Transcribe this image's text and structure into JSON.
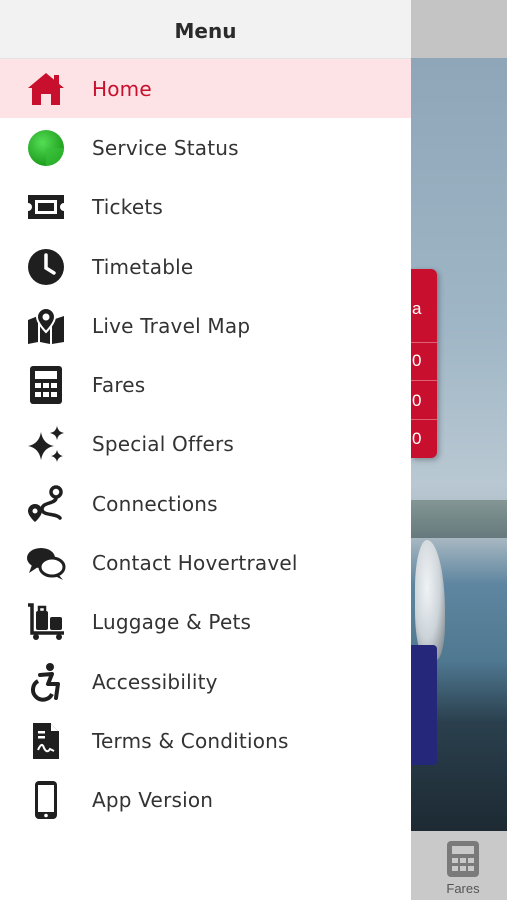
{
  "drawer": {
    "title": "Menu",
    "items": [
      {
        "label": "Home",
        "icon": "home-icon",
        "active": true
      },
      {
        "label": "Service Status",
        "icon": "status-indicator-icon",
        "active": false
      },
      {
        "label": "Tickets",
        "icon": "ticket-icon",
        "active": false
      },
      {
        "label": "Timetable",
        "icon": "clock-icon",
        "active": false
      },
      {
        "label": "Live Travel Map",
        "icon": "map-pin-icon",
        "active": false
      },
      {
        "label": "Fares",
        "icon": "calculator-icon",
        "active": false
      },
      {
        "label": "Special Offers",
        "icon": "sparkles-icon",
        "active": false
      },
      {
        "label": "Connections",
        "icon": "route-icon",
        "active": false
      },
      {
        "label": "Contact Hovertravel",
        "icon": "chat-bubbles-icon",
        "active": false
      },
      {
        "label": "Luggage & Pets",
        "icon": "luggage-trolley-icon",
        "active": false
      },
      {
        "label": "Accessibility",
        "icon": "wheelchair-icon",
        "active": false
      },
      {
        "label": "Terms & Conditions",
        "icon": "document-icon",
        "active": false
      },
      {
        "label": "App Version",
        "icon": "phone-icon",
        "active": false
      }
    ]
  },
  "background": {
    "bottom_tab_label": "Fares",
    "red_card_glyphs": [
      "a",
      "0",
      "0",
      "0"
    ]
  },
  "colors": {
    "accent": "#c8102e",
    "active_row": "#fde3e5",
    "status_green": "#2fc02f",
    "icon": "#1f1f1f",
    "navy": "#25277a"
  }
}
